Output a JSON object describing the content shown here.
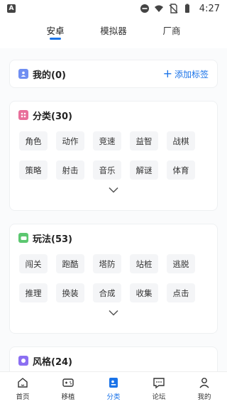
{
  "status_bar": {
    "time": "4:27"
  },
  "top_tabs": [
    {
      "label": "安卓",
      "active": true
    },
    {
      "label": "模拟器",
      "active": false
    },
    {
      "label": "厂商",
      "active": false
    }
  ],
  "mine": {
    "title": "我的(0)",
    "add_label": "添加标签"
  },
  "category": {
    "title": "分类(30)",
    "chips": [
      "角色",
      "动作",
      "竞速",
      "益智",
      "战棋",
      "策略",
      "射击",
      "音乐",
      "解谜",
      "体育"
    ]
  },
  "gameplay": {
    "title": "玩法(53)",
    "chips": [
      "闯关",
      "跑酷",
      "塔防",
      "站桩",
      "逃脱",
      "推理",
      "换装",
      "合成",
      "收集",
      "点击"
    ]
  },
  "style": {
    "title": "风格(24)"
  },
  "bottom_nav": [
    {
      "label": "首页",
      "icon": "home-icon",
      "active": false
    },
    {
      "label": "移植",
      "icon": "gamepad-icon",
      "active": false
    },
    {
      "label": "分类",
      "icon": "category-icon",
      "active": true
    },
    {
      "label": "论坛",
      "icon": "forum-icon",
      "active": false
    },
    {
      "label": "我的",
      "icon": "profile-icon",
      "active": false
    }
  ],
  "colors": {
    "accent": "#1a73e8",
    "mine_icon": "#6f8ef2",
    "category_icon": "#e86f9a",
    "gameplay_icon": "#5cc770",
    "style_icon": "#8b6ff2"
  }
}
